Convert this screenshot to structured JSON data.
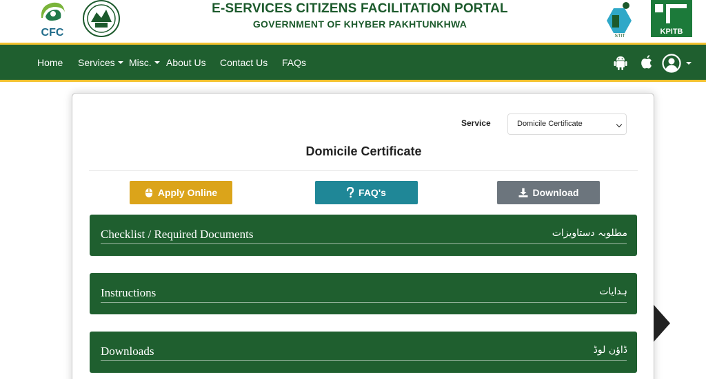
{
  "header": {
    "title": "E-SERVICES CITIZENS FACILITATION PORTAL",
    "subtitle": "GOVERNMENT OF KHYBER PAKHTUNKHWA",
    "logos": {
      "cfc_text": "CFC",
      "stit_text": "STIT",
      "kpitb_text": "KPITB"
    },
    "colors": {
      "brand_green": "#1f5f2f",
      "accent_yellow": "#f2c12e"
    }
  },
  "nav": {
    "items": [
      {
        "label": "Home"
      },
      {
        "label": "Services"
      },
      {
        "label": "Misc."
      },
      {
        "label": "About Us"
      },
      {
        "label": "Contact Us"
      },
      {
        "label": "FAQs"
      }
    ],
    "icons": [
      "android-icon",
      "apple-icon",
      "user-icon"
    ]
  },
  "form": {
    "service_label": "Service",
    "service_selected": "Domicile Certificate"
  },
  "page": {
    "heading": "Domicile Certificate"
  },
  "buttons": {
    "apply": "Apply Online",
    "faqs": "FAQ's",
    "download": "Download"
  },
  "accordions": [
    {
      "en": "Checklist / Required Documents",
      "ur": "مطلوبہ دستاویزات"
    },
    {
      "en": "Instructions",
      "ur": "ہدایات"
    },
    {
      "en": "Downloads",
      "ur": "ڈاؤن لوڈ"
    }
  ]
}
